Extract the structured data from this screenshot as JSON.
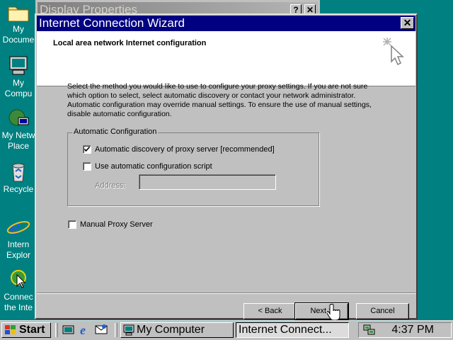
{
  "desktop": {
    "icons": [
      {
        "line1": "My",
        "line2": "Docume",
        "icon": "folder-icon"
      },
      {
        "line1": "My",
        "line2": "Compu",
        "icon": "computer-icon"
      },
      {
        "line1": "My Netw",
        "line2": "Place",
        "icon": "network-icon"
      },
      {
        "line1": "Recycle",
        "line2": "",
        "icon": "recycle-bin-icon"
      },
      {
        "line1": "Intern",
        "line2": "Explor",
        "icon": "internet-explorer-icon"
      },
      {
        "line1": "Connec",
        "line2": "the Inte",
        "icon": "connect-internet-icon"
      }
    ]
  },
  "background_window": {
    "title": "Display Properties",
    "help_label": "?",
    "close_label": "✕"
  },
  "wizard": {
    "title": "Internet Connection Wizard",
    "close_label": "✕",
    "header_title": "Local area network Internet configuration",
    "description": "Select the method you would like to use to configure your proxy settings.  If you are not sure which option to select, select automatic discovery or contact your network administrator.  Automatic configuration may override manual settings.  To ensure the use of manual settings, disable automatic configuration.",
    "group_label": "Automatic Configuration",
    "auto_discovery": {
      "label": "Automatic discovery of proxy server [recommended]",
      "checked": true
    },
    "auto_script": {
      "label": "Use automatic configuration script",
      "checked": false
    },
    "address": {
      "label": "Address:",
      "value": ""
    },
    "manual_proxy": {
      "label": "Manual Proxy Server",
      "checked": false
    },
    "buttons": {
      "back": "< Back",
      "next": "Next >",
      "cancel": "Cancel"
    },
    "colors": {
      "title_bar": "#000080",
      "face": "#c0c0c0"
    }
  },
  "taskbar": {
    "start_label": "Start",
    "tasks": [
      {
        "label": "My Computer",
        "active": false
      },
      {
        "label": "Internet Connect...",
        "active": true
      }
    ],
    "clock": "4:37 PM"
  }
}
